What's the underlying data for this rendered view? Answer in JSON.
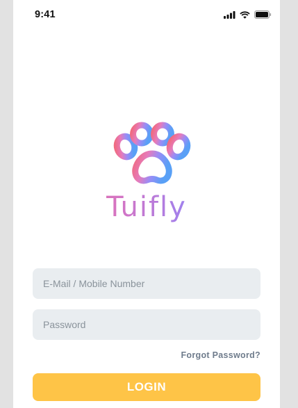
{
  "status_bar": {
    "time": "9:41",
    "icons": [
      "signal-icon",
      "wifi-icon",
      "battery-icon"
    ]
  },
  "brand": {
    "logo_icon": "paw-icon",
    "name": "Tuifly",
    "gradient": [
      "#f06a7f",
      "#d474c4",
      "#8a86ff",
      "#5b9cf5"
    ]
  },
  "form": {
    "email_placeholder": "E-Mail / Mobile Number",
    "password_placeholder": "Password",
    "forgot_password": "Forgot Password?",
    "login_label": "LOGIN"
  },
  "colors": {
    "background": "#e2e2e2",
    "screen": "#ffffff",
    "field_bg": "#e9edf0",
    "accent": "#fec447",
    "link": "#6f7c8c"
  }
}
